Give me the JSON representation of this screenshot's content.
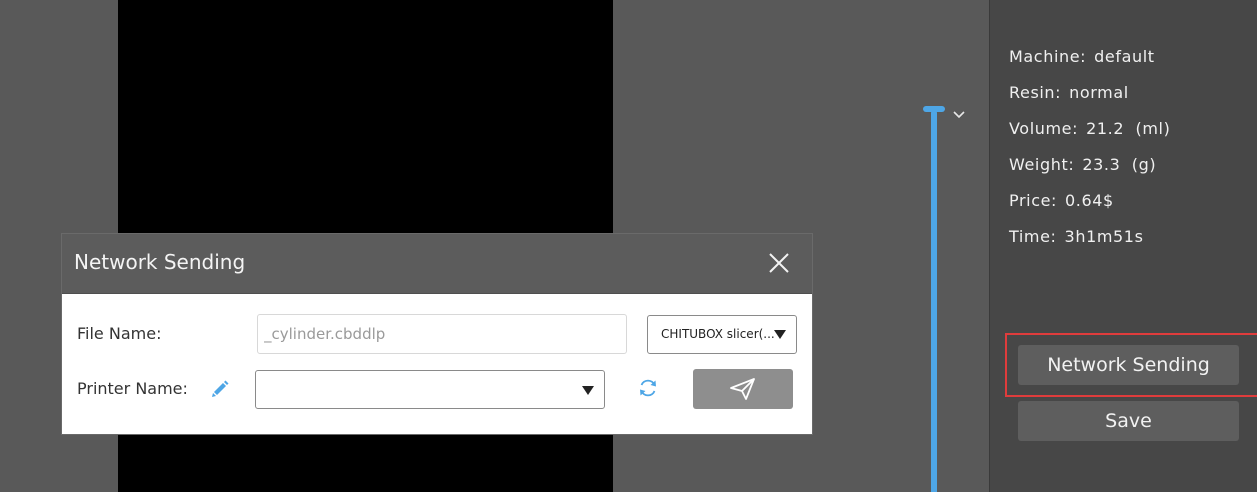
{
  "info": {
    "machine_label": "Machine:",
    "machine_value": "default",
    "resin_label": "Resin:",
    "resin_value": "normal",
    "volume_label": "Volume:",
    "volume_value": "21.2  (ml)",
    "weight_label": "Weight:",
    "weight_value": "23.3  (g)",
    "price_label": "Price:",
    "price_value": "0.64$",
    "time_label": "Time:",
    "time_value": "3h1m51s"
  },
  "panel": {
    "network_sending_label": "Network Sending",
    "save_label": "Save"
  },
  "dialog": {
    "title": "Network Sending",
    "file_name_label": "File Name:",
    "file_name_value": "_cylinder.cbddlp",
    "format_value": "CHITUBOX slicer(...",
    "printer_name_label": "Printer Name:",
    "printer_value": ""
  },
  "colors": {
    "accent_blue": "#4ea6e6",
    "highlight_red": "#e03c3c",
    "panel_bg": "#474747",
    "workspace_bg": "#595959"
  },
  "icons": {
    "close": "close-icon",
    "edit": "pencil-icon",
    "refresh": "refresh-icon",
    "send": "paper-plane-icon",
    "chevron": "chevron-down-icon"
  }
}
